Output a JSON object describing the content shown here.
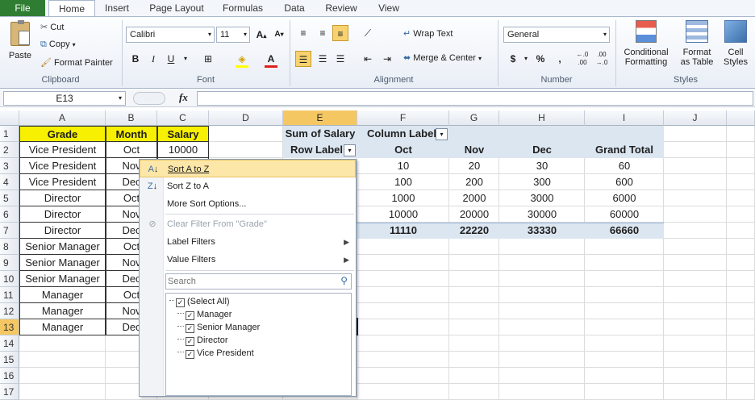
{
  "tabs": {
    "file": "File",
    "items": [
      "Home",
      "Insert",
      "Page Layout",
      "Formulas",
      "Data",
      "Review",
      "View"
    ]
  },
  "ribbon": {
    "clipboard": {
      "paste": "Paste",
      "cut": "Cut",
      "copy": "Copy",
      "format_painter": "Format Painter",
      "label": "Clipboard"
    },
    "font": {
      "name": "Calibri",
      "size": "11",
      "bold": "B",
      "italic": "I",
      "underline": "U",
      "label": "Font"
    },
    "alignment": {
      "wrap": "Wrap Text",
      "merge": "Merge & Center",
      "label": "Alignment"
    },
    "number": {
      "format": "General",
      "currency": "$",
      "percent": "%",
      "comma": ",",
      "inc": ".0→.00",
      "dec": ".00→.0",
      "label": "Number"
    },
    "styles": {
      "cond1": "Conditional",
      "cond2": "Formatting",
      "fat1": "Format",
      "fat2": "as Table",
      "cs1": "Cell",
      "cs2": "Styles",
      "label": "Styles"
    }
  },
  "formula_bar": {
    "namebox": "E13",
    "fx": "fx",
    "value": ""
  },
  "columns": [
    "A",
    "B",
    "C",
    "D",
    "E",
    "F",
    "G",
    "H",
    "I",
    "J"
  ],
  "rows": [
    "1",
    "2",
    "3",
    "4",
    "5",
    "6",
    "7",
    "8",
    "9",
    "10",
    "11",
    "12",
    "13",
    "14",
    "15",
    "16",
    "17"
  ],
  "table": {
    "headers": [
      "Grade",
      "Month",
      "Salary"
    ],
    "rows": [
      [
        "Vice President",
        "Oct",
        "10000"
      ],
      [
        "Vice President",
        "Nov",
        ""
      ],
      [
        "Vice President",
        "Dec",
        ""
      ],
      [
        "Director",
        "Oct",
        ""
      ],
      [
        "Director",
        "Nov",
        ""
      ],
      [
        "Director",
        "Dec",
        ""
      ],
      [
        "Senior Manager",
        "Oct",
        ""
      ],
      [
        "Senior Manager",
        "Nov",
        ""
      ],
      [
        "Senior Manager",
        "Dec",
        ""
      ],
      [
        "Manager",
        "Oct",
        ""
      ],
      [
        "Manager",
        "Nov",
        ""
      ],
      [
        "Manager",
        "Dec",
        ""
      ]
    ]
  },
  "pivot": {
    "sum_label": "Sum of Salary",
    "col_label": "Column Label",
    "row_label": "Row Label",
    "col_headers": [
      "Oct",
      "Nov",
      "Dec",
      "Grand Total"
    ],
    "rows": [
      [
        "10",
        "20",
        "30",
        "60"
      ],
      [
        "100",
        "200",
        "300",
        "600"
      ],
      [
        "1000",
        "2000",
        "3000",
        "6000"
      ],
      [
        "10000",
        "20000",
        "30000",
        "60000"
      ]
    ],
    "total": [
      "11110",
      "22220",
      "33330",
      "66660"
    ]
  },
  "menu": {
    "sort_az": "Sort A to Z",
    "sort_za": "Sort Z to A",
    "more_sort": "More Sort Options...",
    "clear_filter": "Clear Filter From \"Grade\"",
    "label_filters": "Label Filters",
    "value_filters": "Value Filters",
    "search_placeholder": "Search",
    "items": [
      "(Select All)",
      "Manager",
      "Senior Manager",
      "Director",
      "Vice President"
    ]
  },
  "colors": {
    "file_tab": "#2f7d32",
    "header_yellow": "#f7f000",
    "pivot_blue": "#dce6f1",
    "selection": "#f4c762"
  }
}
